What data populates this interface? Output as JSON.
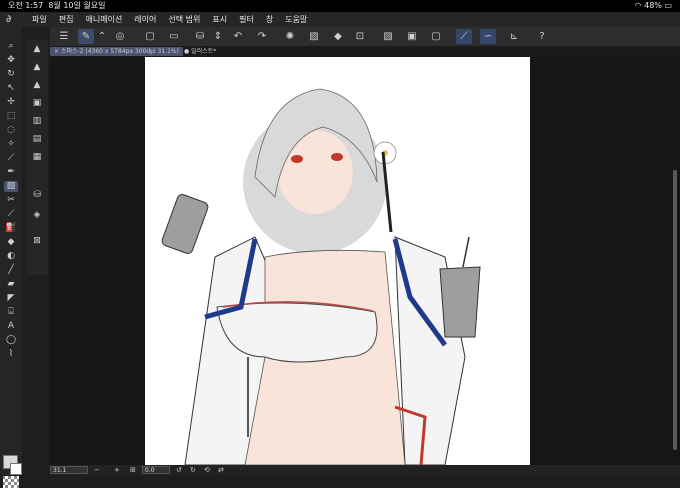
{
  "status": {
    "time": "오전 1:57",
    "date": "8월 10일 월요일",
    "battery": "48%"
  },
  "menu": [
    "파일",
    "편집",
    "애니메이션",
    "레이어",
    "선택 범위",
    "표시",
    "필터",
    "창",
    "도움말"
  ],
  "tabs": [
    {
      "label": "× 스퍼스-2 (4360 x 5784px 300dpi 31.1%)",
      "active": true
    },
    {
      "label": "● 일러스트*",
      "active": false
    }
  ],
  "bottom": {
    "zoom": "31.1",
    "angle": "0.0"
  },
  "colors": {
    "accent": "#4a5370",
    "bg": "#1e1e1e",
    "canvas": "#ffffff"
  }
}
